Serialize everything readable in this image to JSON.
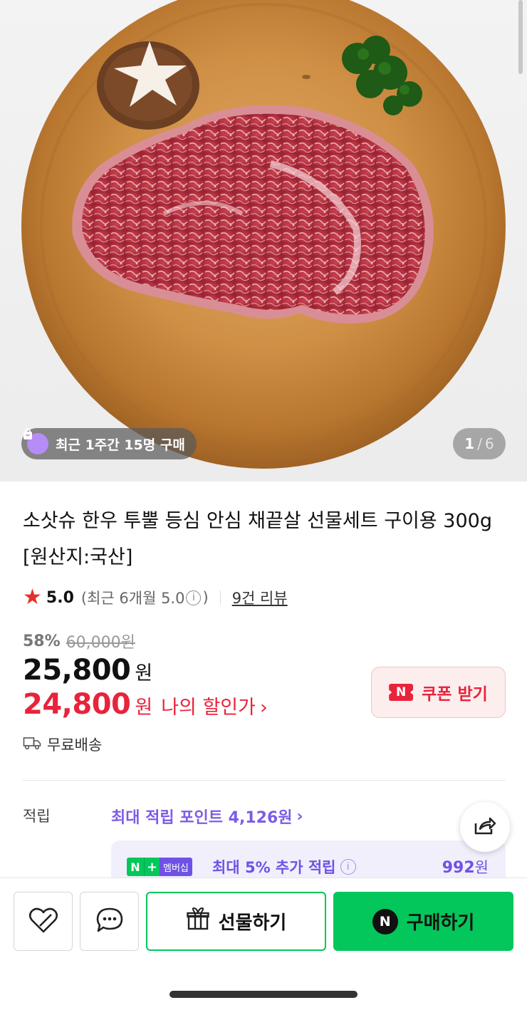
{
  "hero": {
    "badge_text": "최근 1주간 15명 구매",
    "counter_current": "1",
    "counter_sep": "/",
    "counter_total": "6"
  },
  "product": {
    "title": "소삿슈 한우 투뿔 등심 안심 채끝살 선물세트 구이용 300g [원산지:국산]",
    "rating_score": "5.0",
    "rating_recent_prefix": "(최근 6개월 5.0",
    "rating_recent_suffix": ")",
    "reviews_link": "9건 리뷰",
    "discount_rate": "58%",
    "original_price": "60,000원",
    "price": "25,800",
    "price_unit": "원",
    "my_price": "24,800",
    "my_price_unit": "원",
    "my_price_label": "나의 할인가",
    "coupon_label": "쿠폰 받기",
    "shipping": "무료배송"
  },
  "points": {
    "label": "적립",
    "value": "최대 적립 포인트 4,126원",
    "membership_badge": "멤버십",
    "membership_text": "최대 5% 추가 적립",
    "membership_amount": "992",
    "membership_unit": "원"
  },
  "bottom": {
    "gift_label": "선물하기",
    "buy_label": "구매하기"
  },
  "colors": {
    "accent_green": "#03c75a",
    "price_red": "#e8233c",
    "membership_purple": "#6f52e5"
  }
}
